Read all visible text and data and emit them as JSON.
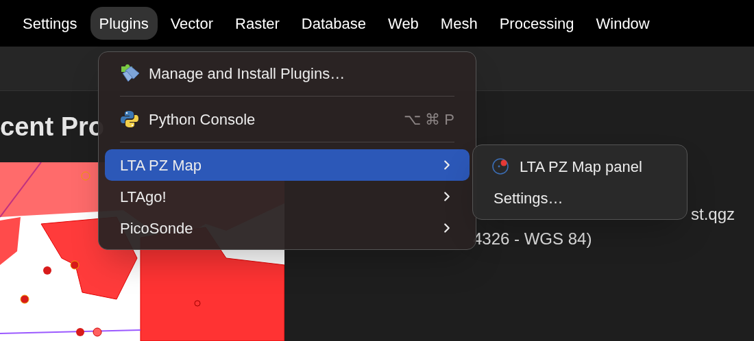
{
  "menu_bar": [
    {
      "label": "Settings",
      "selected": false
    },
    {
      "label": "Plugins",
      "selected": true
    },
    {
      "label": "Vector",
      "selected": false
    },
    {
      "label": "Raster",
      "selected": false
    },
    {
      "label": "Database",
      "selected": false
    },
    {
      "label": "Web",
      "selected": false
    },
    {
      "label": "Mesh",
      "selected": false
    },
    {
      "label": "Processing",
      "selected": false
    },
    {
      "label": "Window",
      "selected": false
    }
  ],
  "background": {
    "heading": "cent Pro",
    "file_name": "st.qgz",
    "crs": "4326 - WGS 84)"
  },
  "plugins_menu": [
    {
      "kind": "item",
      "label": "Manage and Install Plugins…",
      "selected": false
    },
    {
      "kind": "separator"
    },
    {
      "kind": "item",
      "label": "Python Console",
      "shortcut": "⌥ ⌘ P",
      "selected": false
    },
    {
      "kind": "separator"
    },
    {
      "kind": "submenu",
      "label": "LTA PZ Map",
      "selected": true
    },
    {
      "kind": "submenu",
      "label": "LTAgo!",
      "selected": false
    },
    {
      "kind": "submenu",
      "label": "PicoSonde",
      "selected": false
    }
  ],
  "submenu": [
    {
      "label": "LTA PZ Map panel",
      "selected": false
    },
    {
      "label": "Settings…",
      "selected": false
    }
  ]
}
